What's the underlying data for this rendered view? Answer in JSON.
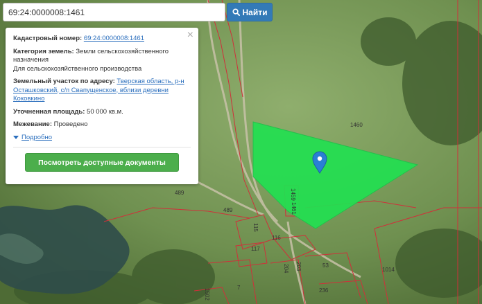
{
  "search": {
    "query": "69:24:0000008:1461",
    "button_label": "Найти",
    "icon": "search-icon"
  },
  "popup": {
    "close_glyph": "×",
    "cadastral_label": "Кадастровый номер:",
    "cadastral_value": "69:24:0000008:1461",
    "category_label": "Категория земель:",
    "category_value": "Земли сельскохозяйственного назначения",
    "usage_value": "Для сельскохозяйственного производства",
    "address_label": "Земельный участок по адресу:",
    "address_value": "Тверская область, р-н Осташковский, с/п Свапущенское, вблизи деревни Коковкино",
    "area_label": "Уточненная площадь:",
    "area_value": "50 000 кв.м.",
    "survey_label": "Межевание:",
    "survey_value": "Проведено",
    "more_label": "Подробно",
    "docs_button": "Посмотреть доступные документы"
  },
  "map": {
    "parcel_labels": [
      "1460",
      "489",
      "489",
      "1014",
      "1459",
      "1461",
      "115",
      "116",
      "117",
      "204",
      "203",
      "53",
      "7",
      "236",
      "1502"
    ],
    "highlight_color": "#22e051",
    "boundary_color": "#d0303a",
    "marker_color": "#2a7fd4",
    "marker_icon": "map-pin-icon"
  }
}
